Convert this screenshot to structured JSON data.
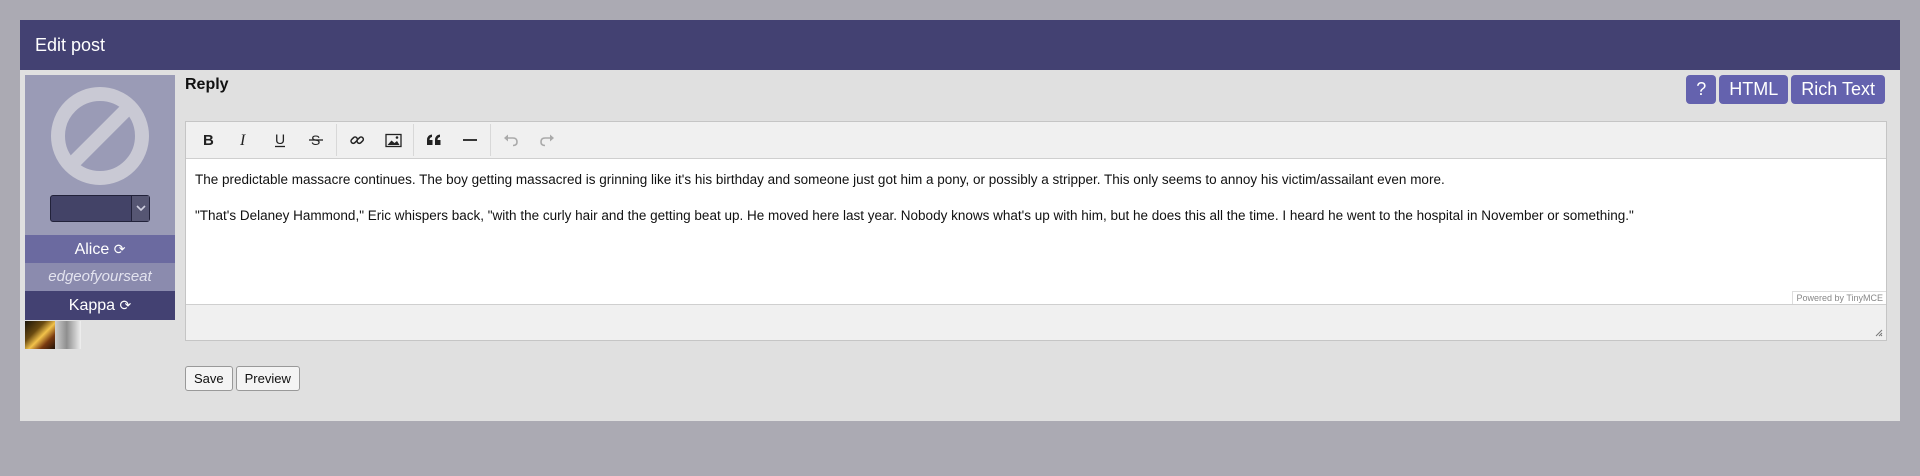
{
  "panel": {
    "title": "Edit post"
  },
  "sidebar": {
    "name": "Alice",
    "username": "edgeofyourseat",
    "group": "Kappa",
    "avatar_icon": "no-avatar-icon",
    "refresh_icon": "refresh-icon"
  },
  "reply": {
    "title": "Reply",
    "mode_buttons": [
      "?",
      "HTML",
      "Rich Text"
    ]
  },
  "toolbar": {
    "buttons": [
      "bold",
      "italic",
      "underline",
      "strikethrough",
      "link",
      "image",
      "blockquote",
      "horizontal-rule",
      "undo",
      "redo"
    ]
  },
  "editor": {
    "paragraphs": [
      "The predictable massacre continues. The boy getting massacred is grinning like it's his birthday and someone just got him a pony, or possibly a stripper. This only seems to annoy his victim/assailant even more.",
      "\"That's Delaney Hammond,\" Eric whispers back, \"with the curly hair and the getting beat up. He moved here last year. Nobody knows what's up with him, but he does this all the time. I heard he went to the hospital in November or something.\""
    ],
    "powered_by": "Powered by TinyMCE"
  },
  "form": {
    "save_label": "Save",
    "preview_label": "Preview"
  }
}
